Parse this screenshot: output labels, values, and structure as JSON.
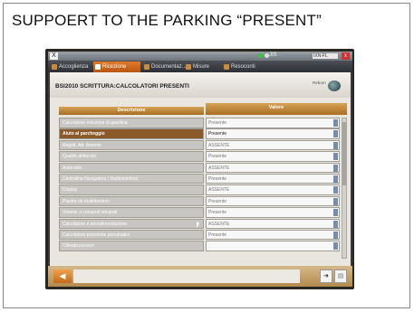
{
  "caption": "SUPPOERT TO THE PARKING “PRESENT”",
  "app": {
    "logo": "X",
    "status_indicator": "JIS",
    "status_field": "IXN-FL",
    "close_label": "x",
    "tabs": [
      {
        "label": "Accoglienza"
      },
      {
        "label": "Ricezione"
      },
      {
        "label": "Documentaz..."
      },
      {
        "label": "Misure"
      },
      {
        "label": "Resoconti"
      }
    ],
    "active_tab_index": 1
  },
  "panel": {
    "title": "BSI2010  SCRITTURA:CALCOLATORI PRESENTI",
    "sublabel": "Reborn",
    "columns": {
      "description": "Descrizione",
      "value": "Valore"
    }
  },
  "rows": [
    {
      "desc": "Calcolatore iniezione di gasolina",
      "value": "Presente",
      "selected": false
    },
    {
      "desc": "Aiuto al parcheggio",
      "value": "Presente",
      "selected": true
    },
    {
      "desc": "Regolt. Ad. Amento",
      "value": "ASSENTE",
      "selected": false
    },
    {
      "desc": "Qualità abitacolo",
      "value": "Presente",
      "selected": false
    },
    {
      "desc": "Autoradio",
      "value": "ASSENTE",
      "selected": false
    },
    {
      "desc": "Centralina Navigatore / Radiotelefono",
      "value": "Presente",
      "selected": false
    },
    {
      "desc": "Display",
      "value": "ASSENTE",
      "selected": false
    },
    {
      "desc": "Piastra de multifunzioni",
      "value": "Presente",
      "selected": false
    },
    {
      "desc": "Volante a comandi integrati",
      "value": "Presente",
      "selected": false
    },
    {
      "desc": "Calcolatore a sovralimentazione",
      "value": "ASSENTE",
      "selected": false
    },
    {
      "desc": "Calcolatore pressione pneumatici",
      "value": "Presente",
      "selected": false
    },
    {
      "desc": "Climatizzazione",
      "value": "",
      "selected": false
    }
  ],
  "footer": {
    "back_icon": "arrow-left-icon",
    "confirm_icon": "arrow-right-icon",
    "print_icon": "print-icon"
  },
  "colors": {
    "accent": "#d06a1a",
    "header": "#b9802f",
    "selected_row": "#8a5a2a",
    "footer": "#c8a56c"
  }
}
